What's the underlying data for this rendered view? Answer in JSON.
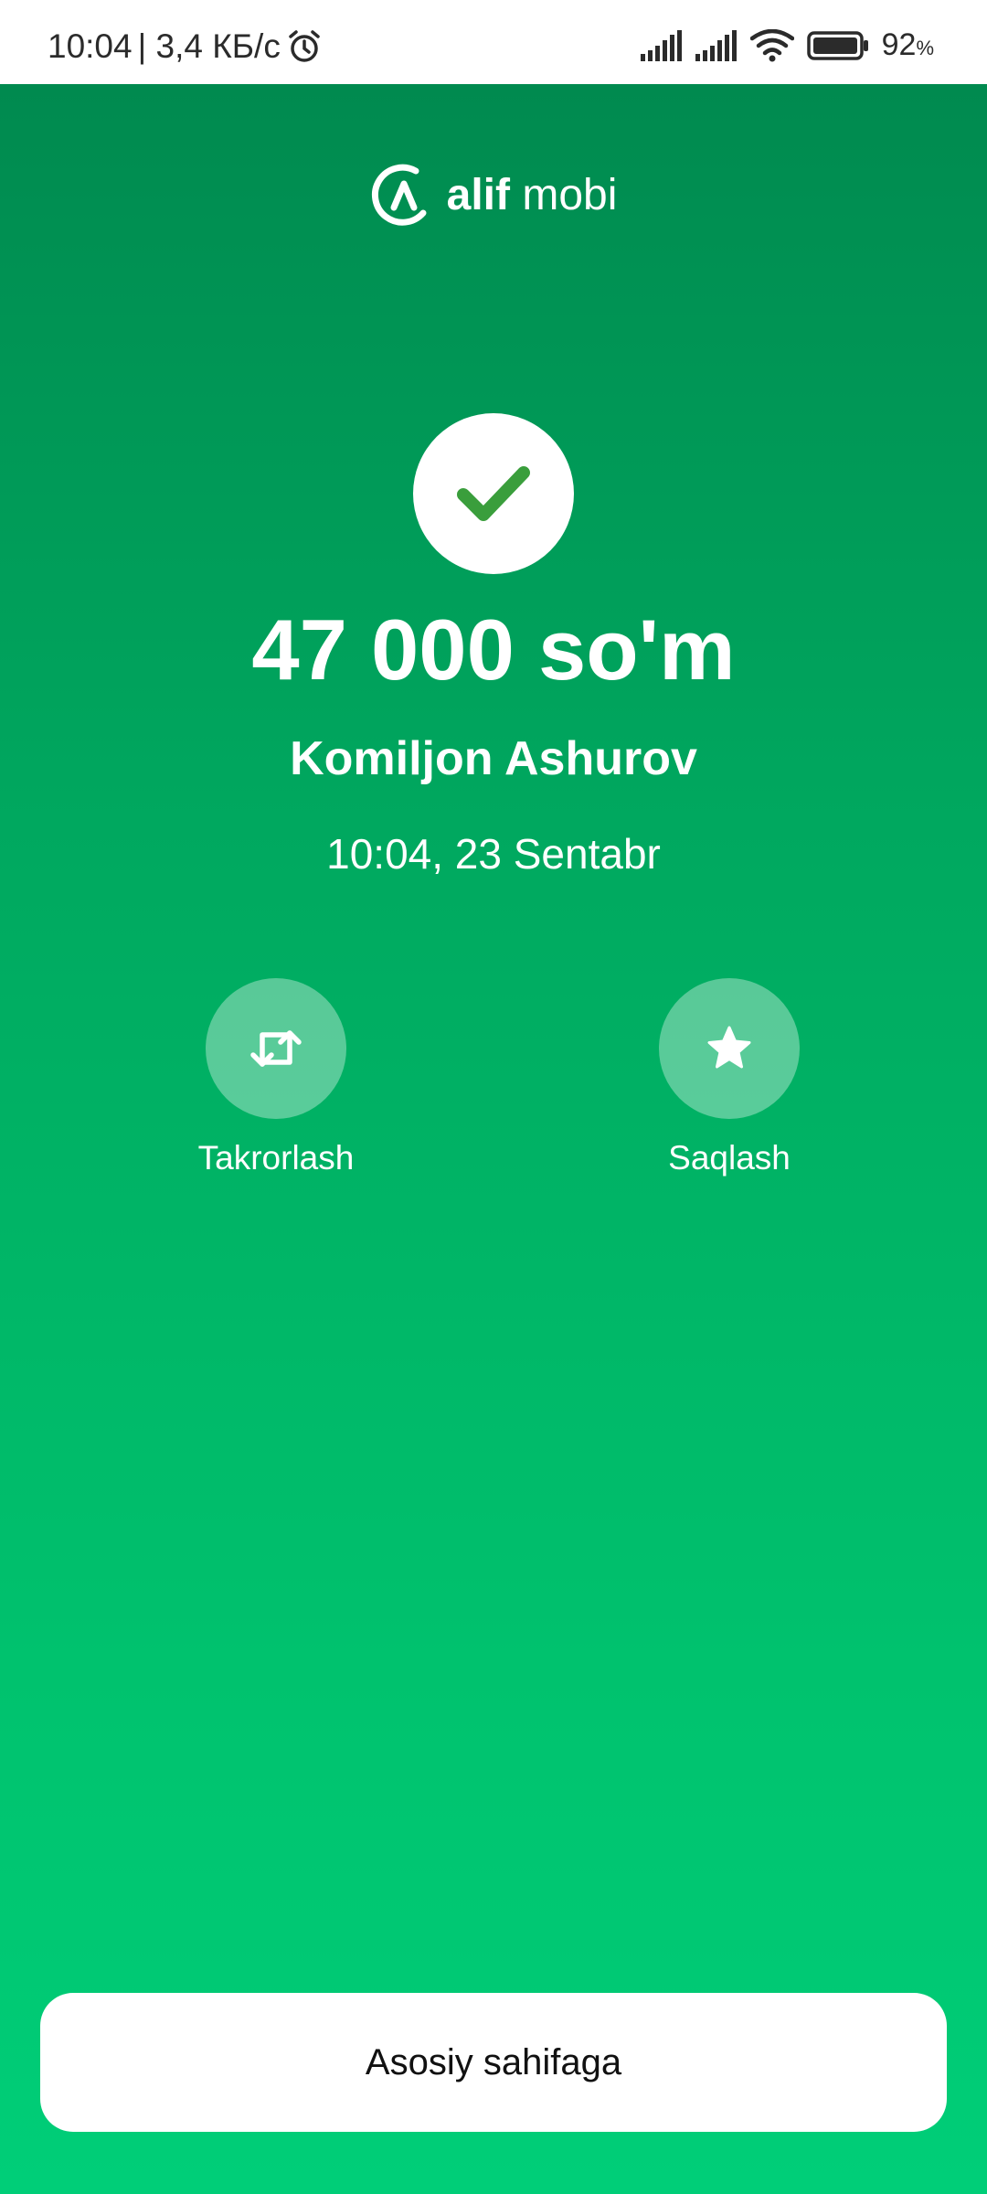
{
  "status_bar": {
    "time": "10:04",
    "network_speed": "| 3,4 КБ/с",
    "battery_percent": "92",
    "battery_unit": "%",
    "icons": [
      "alarm-icon",
      "signal-icon",
      "signal-icon",
      "wifi-icon",
      "battery-icon"
    ]
  },
  "logo": {
    "brand_bold": "alif",
    "brand_light": "mobi"
  },
  "result": {
    "amount": "47 000 so'm",
    "recipient": "Komiljon Ashurov",
    "datetime": "10:04, 23 Sentabr",
    "status_icon": "check-icon"
  },
  "actions": [
    {
      "label": "Takrorlash",
      "icon": "repeat-icon"
    },
    {
      "label": "Saqlash",
      "icon": "star-icon"
    }
  ],
  "home_button": {
    "label": "Asosiy sahifaga"
  },
  "colors": {
    "gradient_top": "#008a4f",
    "gradient_bottom": "#00ce78",
    "check_green": "#3a9e3c",
    "text_on_green": "#ffffff"
  }
}
